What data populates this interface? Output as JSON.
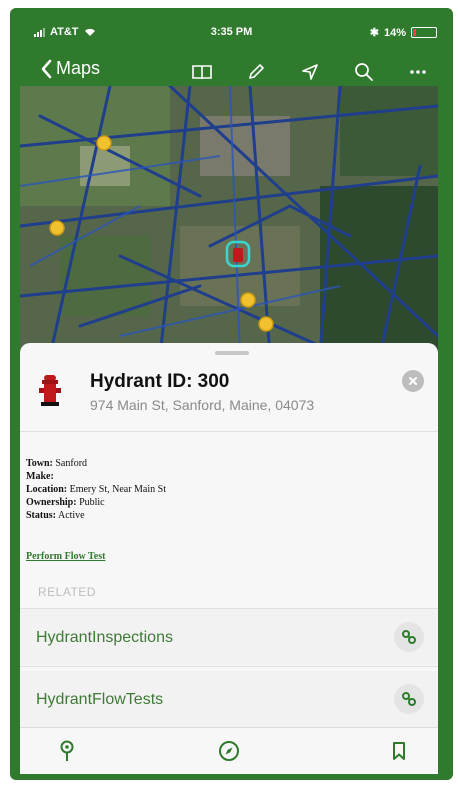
{
  "status_bar": {
    "carrier": "AT&T",
    "time": "3:35 PM",
    "battery_percent": "14%",
    "battery_level": 0.14
  },
  "nav": {
    "back_label": "Maps",
    "icons": [
      "book-icon",
      "pencil-icon",
      "location-arrow-icon",
      "search-icon",
      "more-icon"
    ]
  },
  "map": {
    "alt": "satellite map with pipe network"
  },
  "feature": {
    "title": "Hydrant ID: 300",
    "address": "974 Main St, Sanford, Maine, 04073"
  },
  "popup": {
    "fields": [
      {
        "label": "Town:",
        "value": "Sanford"
      },
      {
        "label": "Make:",
        "value": ""
      },
      {
        "label": "Location:",
        "value": "Emery St, Near Main St"
      },
      {
        "label": "Ownership:",
        "value": "Public"
      },
      {
        "label": "Status:",
        "value": "Active"
      }
    ],
    "link": "Perform Flow Test"
  },
  "related": {
    "label": "RELATED",
    "items": [
      "HydrantInspections",
      "HydrantFlowTests"
    ]
  },
  "tabs": [
    "pin-icon",
    "compass-icon",
    "bookmark-icon"
  ],
  "colors": {
    "brand_green": "#2f7a2c",
    "link_green": "#3f7a37",
    "hydrant_red": "#c0191c"
  }
}
